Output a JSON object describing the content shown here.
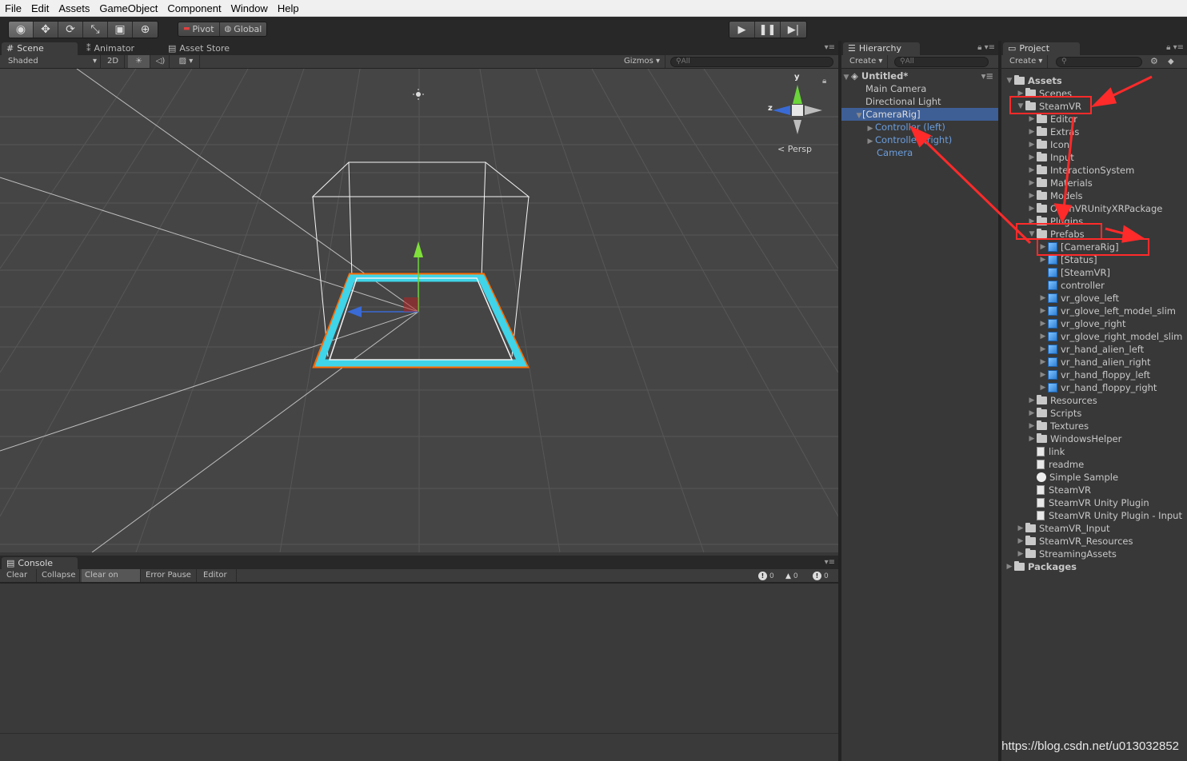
{
  "menu": [
    "File",
    "Edit",
    "Assets",
    "GameObject",
    "Component",
    "Window",
    "Help"
  ],
  "toolbar": {
    "pivot_label": "Pivot",
    "global_label": "Global"
  },
  "scene_tabs": {
    "scene": "Scene",
    "animator": "Animator",
    "asset_store": "Asset Store"
  },
  "scene_bar": {
    "shading": "Shaded",
    "mode_2d": "2D",
    "gizmos": "Gizmos",
    "search_placeholder": "All"
  },
  "scene": {
    "persp_label": "Persp",
    "axis_y": "y",
    "axis_z": "z"
  },
  "console": {
    "tab": "Console",
    "buttons": [
      "Clear",
      "Collapse",
      "Clear on Play",
      "Error Pause",
      "Editor"
    ],
    "counts": [
      "0",
      "0",
      "0"
    ]
  },
  "hierarchy": {
    "tab": "Hierarchy",
    "create": "Create",
    "search_placeholder": "All",
    "items": [
      "Untitled*",
      "Main Camera",
      "Directional Light",
      "[CameraRig]",
      "Controller (left)",
      "Controller (right)",
      "Camera"
    ]
  },
  "project": {
    "tab": "Project",
    "create": "Create",
    "items": [
      "Assets",
      "Scenes",
      "SteamVR",
      "Editor",
      "Extras",
      "Icon",
      "Input",
      "InteractionSystem",
      "Materials",
      "Models",
      "OpenVRUnityXRPackage",
      "Plugins",
      "Prefabs",
      "[CameraRig]",
      "[Status]",
      "[SteamVR]",
      "controller",
      "vr_glove_left",
      "vr_glove_left_model_slim",
      "vr_glove_right",
      "vr_glove_right_model_slim",
      "vr_hand_alien_left",
      "vr_hand_alien_right",
      "vr_hand_floppy_left",
      "vr_hand_floppy_right",
      "Resources",
      "Scripts",
      "Textures",
      "WindowsHelper",
      "link",
      "readme",
      "Simple Sample",
      "SteamVR",
      "SteamVR Unity Plugin",
      "SteamVR Unity Plugin - Input",
      "SteamVR_Input",
      "SteamVR_Resources",
      "StreamingAssets",
      "Packages"
    ]
  },
  "watermark": "https://blog.csdn.net/u013032852",
  "colors": {
    "annotation": "#ff2a2a",
    "selection": "#3e5f96",
    "link_blue": "#6b9ede",
    "play_area": "#3fd4e8"
  }
}
